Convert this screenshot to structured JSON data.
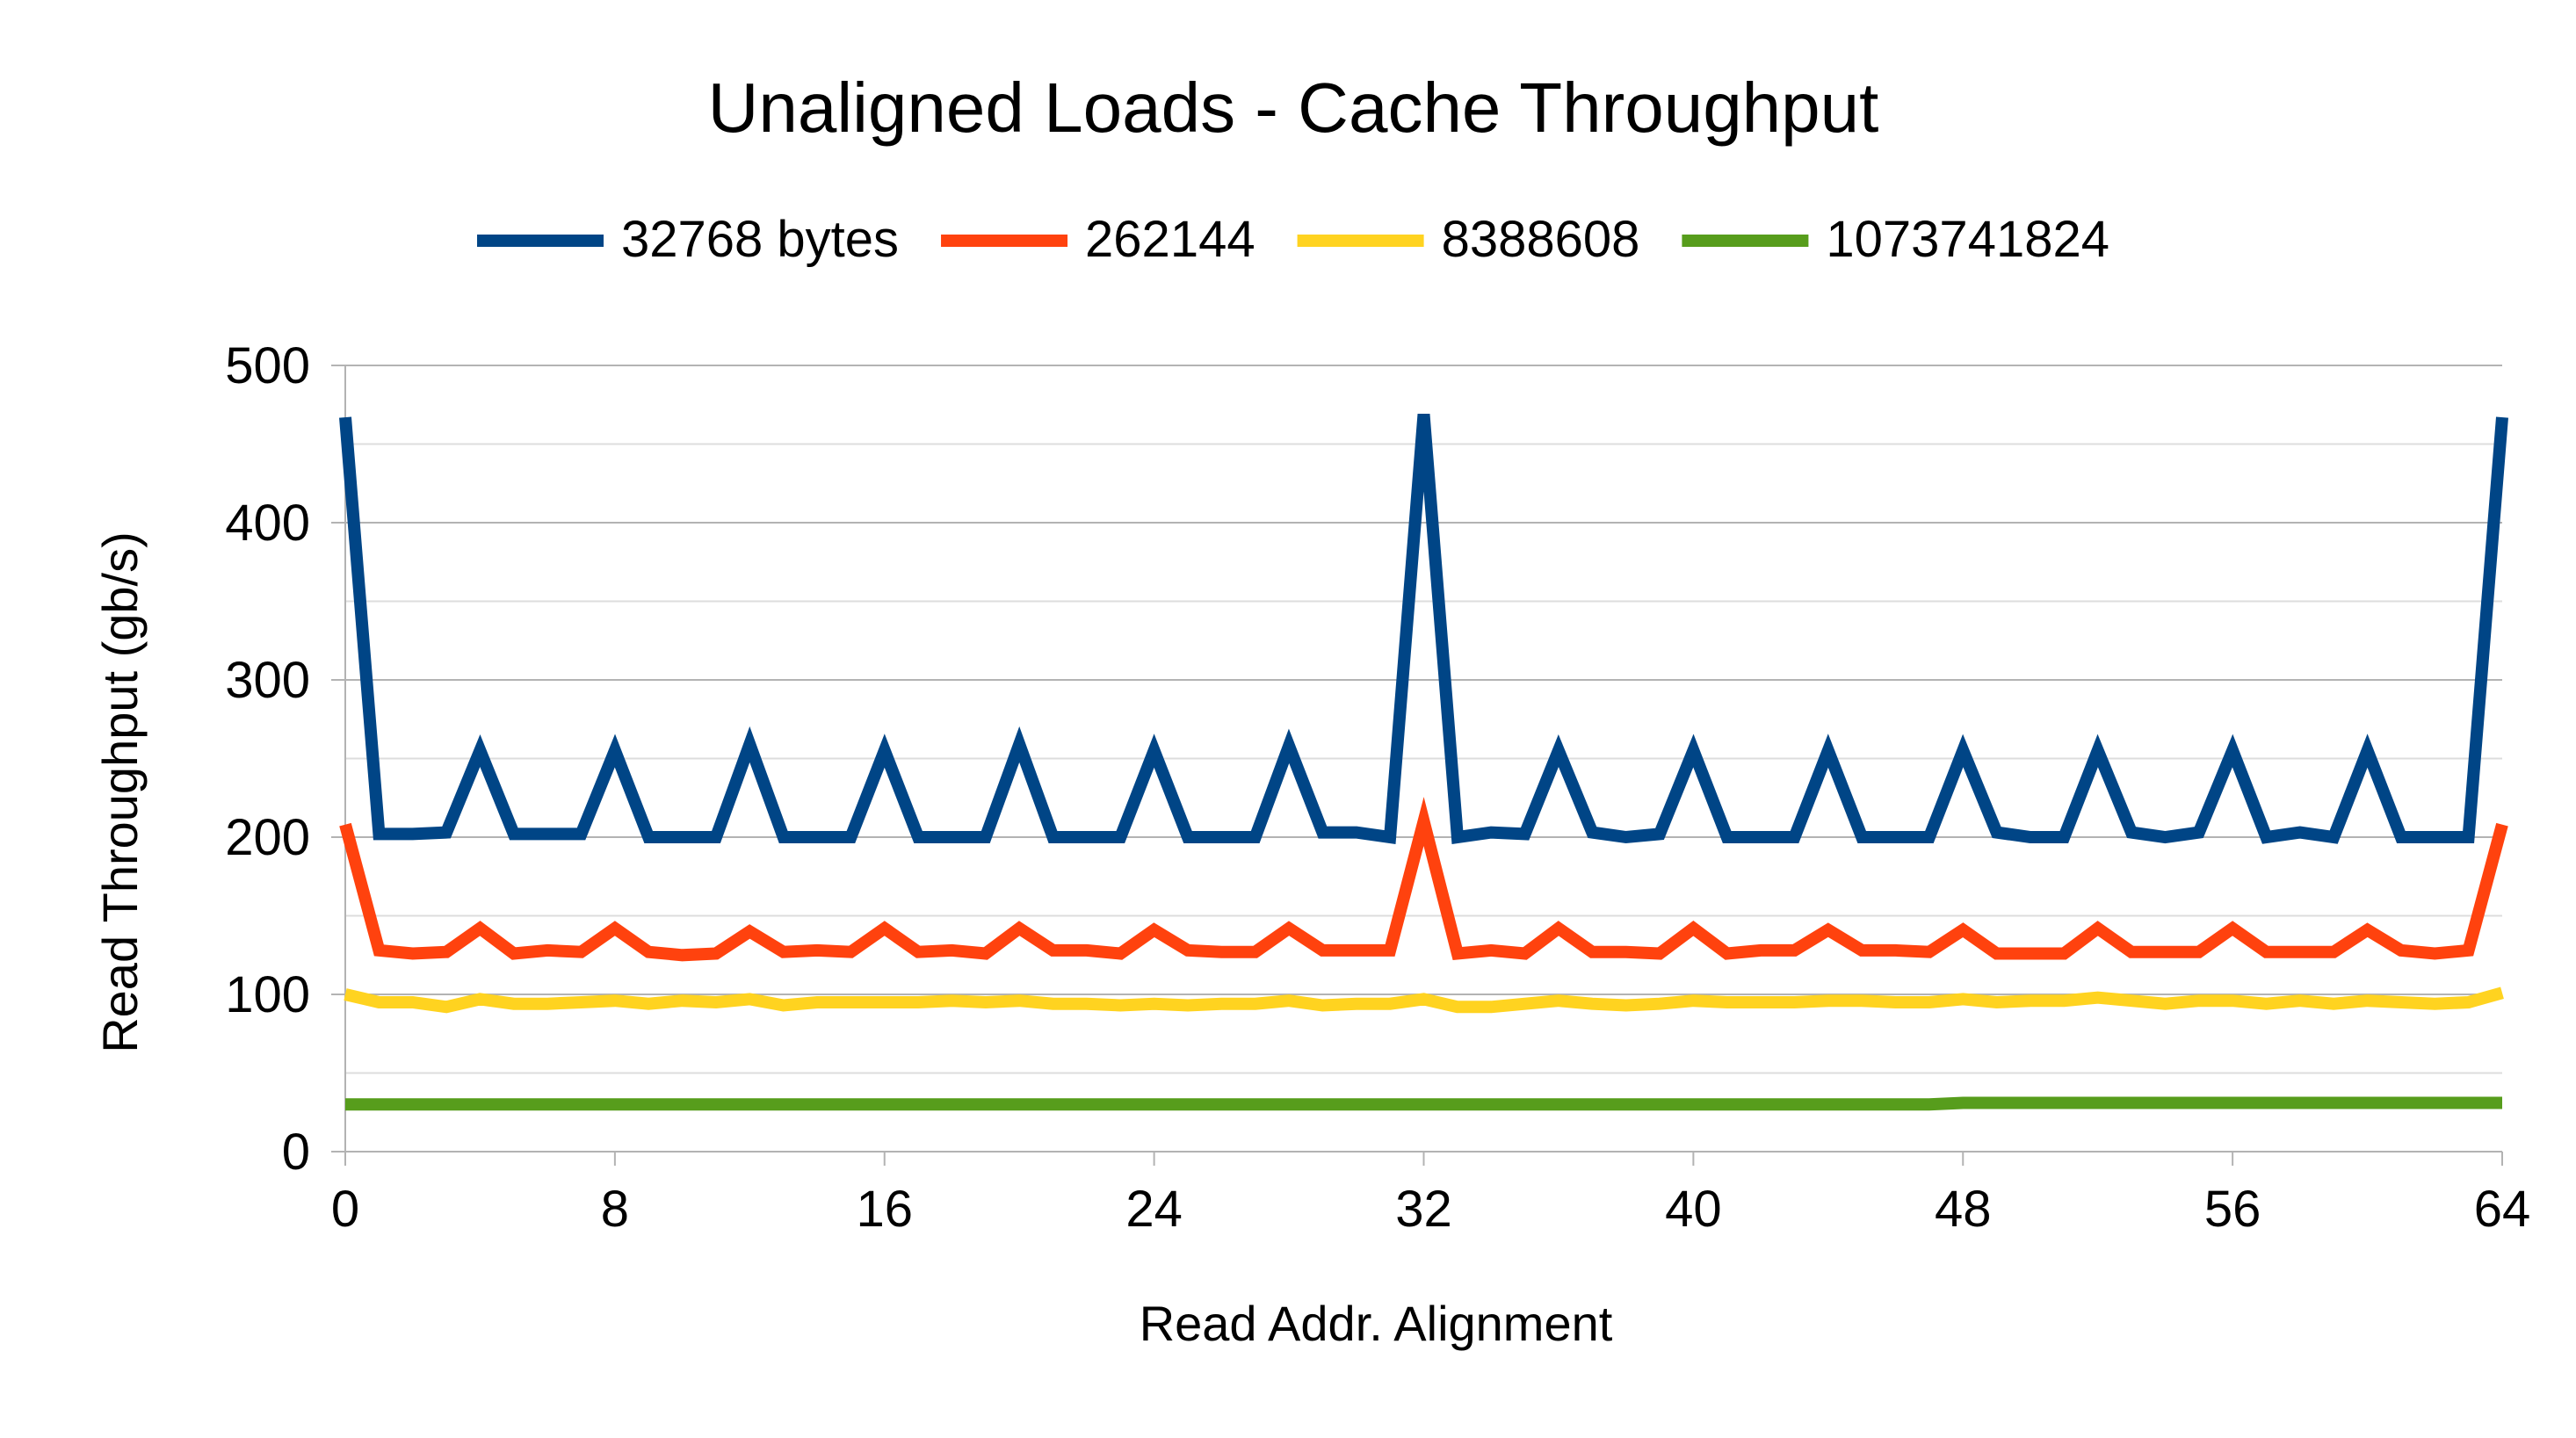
{
  "chart_data": {
    "type": "line",
    "title": "Unaligned Loads - Cache Throughput",
    "xlabel": "Read Addr. Alignment",
    "ylabel": "Read Throughput (gb/s)",
    "xlim": [
      0,
      64
    ],
    "ylim": [
      0,
      500
    ],
    "xticks": [
      0,
      8,
      16,
      24,
      32,
      40,
      48,
      56,
      64
    ],
    "yticks": [
      0,
      100,
      200,
      300,
      400,
      500
    ],
    "grid": true,
    "legend_position": "top",
    "x": [
      0,
      1,
      2,
      3,
      4,
      5,
      6,
      7,
      8,
      9,
      10,
      11,
      12,
      13,
      14,
      15,
      16,
      17,
      18,
      19,
      20,
      21,
      22,
      23,
      24,
      25,
      26,
      27,
      28,
      29,
      30,
      31,
      32,
      33,
      34,
      35,
      36,
      37,
      38,
      39,
      40,
      41,
      42,
      43,
      44,
      45,
      46,
      47,
      48,
      49,
      50,
      51,
      52,
      53,
      54,
      55,
      56,
      57,
      58,
      59,
      60,
      61,
      62,
      63,
      64
    ],
    "series": [
      {
        "name": "32768 bytes",
        "color": "#004586",
        "values": [
          467,
          202,
          202,
          203,
          255,
          202,
          202,
          202,
          255,
          200,
          200,
          200,
          259,
          200,
          200,
          200,
          255,
          200,
          200,
          200,
          259,
          200,
          200,
          200,
          255,
          200,
          200,
          200,
          258,
          203,
          203,
          200,
          469,
          200,
          203,
          202,
          255,
          203,
          200,
          202,
          255,
          200,
          200,
          200,
          255,
          200,
          200,
          200,
          255,
          203,
          200,
          200,
          255,
          203,
          200,
          203,
          255,
          200,
          203,
          200,
          255,
          200,
          200,
          200,
          467
        ]
      },
      {
        "name": "262144",
        "color": "#ff420e",
        "values": [
          208,
          128,
          126,
          127,
          142,
          126,
          128,
          127,
          142,
          127,
          125,
          126,
          140,
          127,
          128,
          127,
          142,
          127,
          128,
          126,
          142,
          128,
          128,
          126,
          141,
          128,
          127,
          127,
          142,
          128,
          128,
          128,
          210,
          126,
          128,
          126,
          142,
          127,
          127,
          126,
          142,
          126,
          128,
          128,
          141,
          128,
          128,
          127,
          141,
          126,
          126,
          126,
          142,
          127,
          127,
          127,
          142,
          127,
          127,
          127,
          141,
          128,
          126,
          128,
          208
        ]
      },
      {
        "name": "8388608",
        "color": "#ffd320",
        "values": [
          100,
          95,
          95,
          92,
          97,
          94,
          94,
          95,
          96,
          94,
          96,
          95,
          97,
          93,
          95,
          95,
          95,
          95,
          96,
          95,
          96,
          94,
          94,
          93,
          94,
          93,
          94,
          94,
          96,
          93,
          94,
          94,
          97,
          92,
          92,
          94,
          96,
          94,
          93,
          94,
          96,
          95,
          95,
          95,
          96,
          96,
          95,
          95,
          97,
          95,
          96,
          96,
          98,
          96,
          94,
          96,
          96,
          94,
          96,
          94,
          96,
          95,
          94,
          95,
          101
        ]
      },
      {
        "name": "1073741824",
        "color": "#579d1c",
        "values": [
          30,
          30,
          30,
          30,
          30,
          30,
          30,
          30,
          30,
          30,
          30,
          30,
          30,
          30,
          30,
          30,
          30,
          30,
          30,
          30,
          30,
          30,
          30,
          30,
          30,
          30,
          30,
          30,
          30,
          30,
          30,
          30,
          30,
          30,
          30,
          30,
          30,
          30,
          30,
          30,
          30,
          30,
          30,
          30,
          30,
          30,
          30,
          30,
          31,
          31,
          31,
          31,
          31,
          31,
          31,
          31,
          31,
          31,
          31,
          31,
          31,
          31,
          31,
          31,
          31
        ]
      }
    ]
  }
}
